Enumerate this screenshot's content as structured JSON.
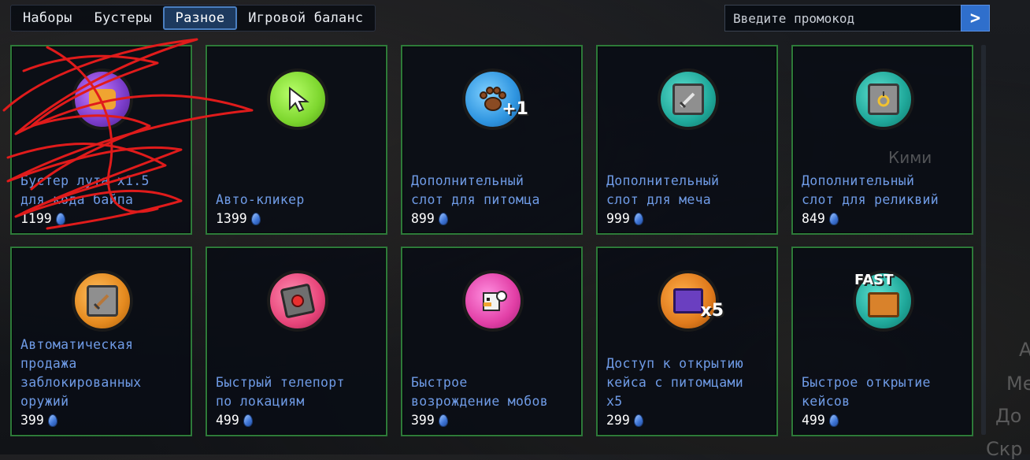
{
  "tabs": [
    {
      "label": "Наборы",
      "active": false
    },
    {
      "label": "Бустеры",
      "active": false
    },
    {
      "label": "Разное",
      "active": true
    },
    {
      "label": "Игровой баланс",
      "active": false
    }
  ],
  "promo": {
    "placeholder": "Введите промокод",
    "submit_icon": ">"
  },
  "currency_icon": "blue-gem-icon",
  "items": [
    {
      "name": "Бустер лута x1.5\nдля кода байпа",
      "price": "1199",
      "icon": "booster-icon",
      "icon_color": "#7a3cc9"
    },
    {
      "name": "Авто-кликер",
      "price": "1399",
      "icon": "cursor-click-icon",
      "icon_color": "#7dd62e"
    },
    {
      "name": "Дополнительный\nслот для питомца",
      "price": "899",
      "icon": "paw-icon",
      "icon_color": "#2f95e0",
      "badge": "+1"
    },
    {
      "name": "Дополнительный\nслот для меча",
      "price": "999",
      "icon": "sword-slot-icon",
      "icon_color": "#1fa89a"
    },
    {
      "name": "Дополнительный\nслот для реликвий",
      "price": "849",
      "icon": "relic-slot-icon",
      "icon_color": "#1fa89a"
    },
    {
      "name": "Автоматическая\nпродажа\nзаблокированных\nоружий",
      "price": "399",
      "icon": "auto-sell-sword-icon",
      "icon_color": "#e58a1f"
    },
    {
      "name": "Быстрый телепорт\nпо локациям",
      "price": "499",
      "icon": "teleport-button-icon",
      "icon_color": "#e8457a"
    },
    {
      "name": "Быстрое\nвозрождение мобов",
      "price": "399",
      "icon": "mob-respawn-icon",
      "icon_color": "#e23fa6"
    },
    {
      "name": "Доступ к открытию\nкейса с питомцами\nх5",
      "price": "299",
      "icon": "pet-case-x5-icon",
      "icon_color": "#e07a1c",
      "badge": "x5"
    },
    {
      "name": "Быстрое открытие\nкейсов",
      "price": "499",
      "icon": "fast-case-icon",
      "icon_color": "#1fa89a",
      "badge": "FAST"
    }
  ],
  "colors": {
    "card_border": "#2d7a39",
    "item_name": "#6f9be6",
    "tab_active_bg": "#1d3a5f",
    "promo_button": "#2f6fcc",
    "scribble": "#e01b1b"
  },
  "background_text": [
    "Кими",
    "А",
    "Ме",
    "До",
    "Скр"
  ]
}
